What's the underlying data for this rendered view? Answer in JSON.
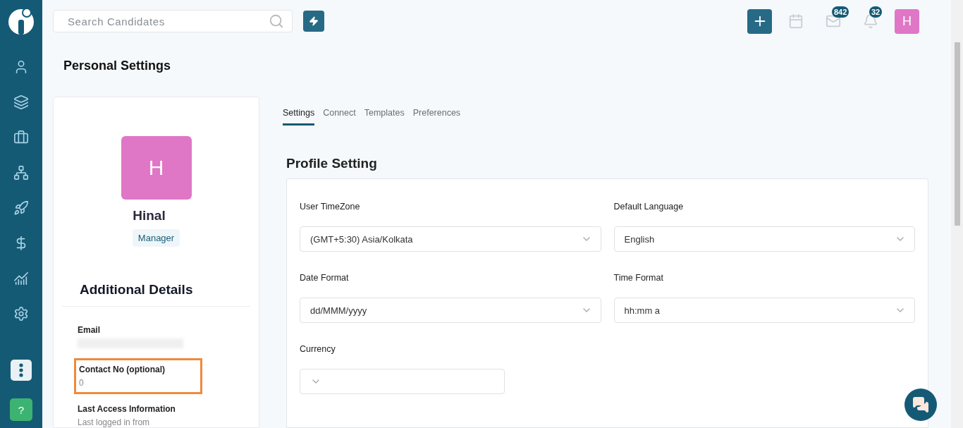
{
  "topbar": {
    "search": {
      "placeholder": "Search Candidates"
    },
    "mail_badge": "842",
    "bell_badge": "32",
    "avatar": "H"
  },
  "page_title": "Personal Settings",
  "profile": {
    "avatar": "H",
    "name": "Hinal",
    "role": "Manager",
    "section_title": "Additional Details",
    "details": [
      {
        "kind": "redacted",
        "label": "Email",
        "highlighted": false
      },
      {
        "kind": "text",
        "label": "Contact No (optional)",
        "value": "0",
        "highlighted": true
      },
      {
        "kind": "text",
        "label": "Last Access Information",
        "value": "Last logged in from",
        "highlighted": false
      }
    ]
  },
  "tabs": [
    {
      "label": "Settings",
      "selected": true
    },
    {
      "label": "Connect",
      "selected": false
    },
    {
      "label": "Templates",
      "selected": false
    },
    {
      "label": "Preferences",
      "selected": false
    }
  ],
  "profile_setting": {
    "title": "Profile Setting",
    "fields": [
      {
        "label": "User TimeZone",
        "value": "(GMT+5:30) Asia/Kolkata"
      },
      {
        "label": "Default Language",
        "value": "English"
      },
      {
        "label": "Date Format",
        "value": "dd/MMM/yyyy"
      },
      {
        "label": "Time Format",
        "value": "hh:mm a"
      },
      {
        "label": "Currency"
      }
    ]
  },
  "help_button": "?"
}
